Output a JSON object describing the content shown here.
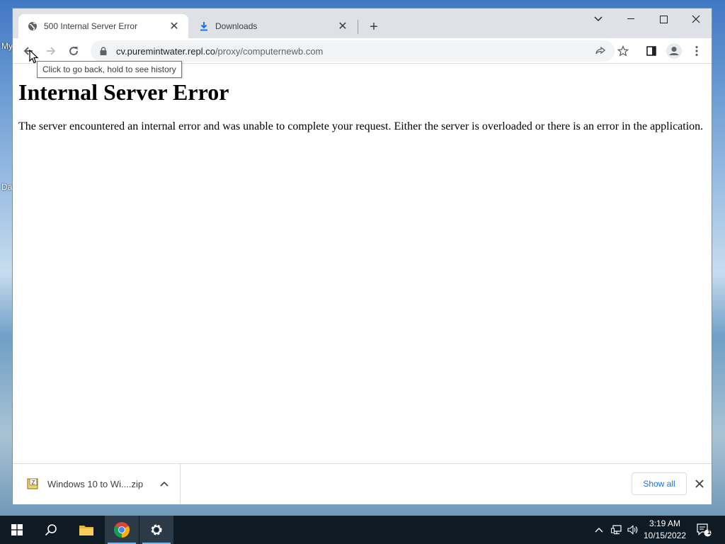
{
  "desktop": {
    "label_top": "My",
    "label_bottom": "Da"
  },
  "browser": {
    "tabs": [
      {
        "title": "500 Internal Server Error",
        "icon": "globe-icon"
      },
      {
        "title": "Downloads",
        "icon": "download-icon"
      }
    ],
    "address": {
      "host": "cv.puremintwater.repl.co",
      "path": "/proxy/computernewb.com"
    },
    "tooltip": "Click to go back, hold to see history"
  },
  "page": {
    "heading": "Internal Server Error",
    "message": "The server encountered an internal error and was unable to complete your request. Either the server is overloaded or there is an error in the application."
  },
  "downloads_bar": {
    "file_name": "Windows 10 to Wi....zip",
    "show_all_label": "Show all"
  },
  "taskbar": {
    "time": "3:19 AM",
    "date": "10/15/2022",
    "notification_count": "1"
  },
  "colors": {
    "accent": "#1a73e8",
    "taskbar": "#0f1b24"
  }
}
